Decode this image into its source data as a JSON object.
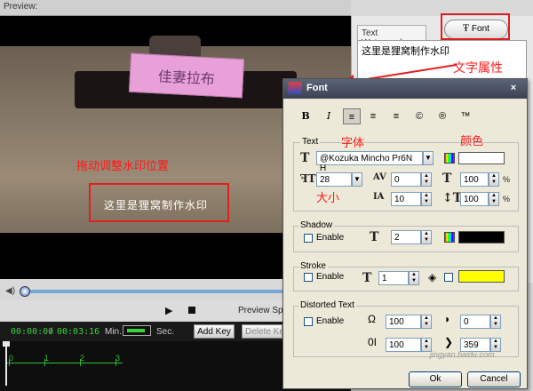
{
  "preview": {
    "label": "Preview:"
  },
  "video": {
    "card_text": "佳妻拉布",
    "drag_hint": "拖动调整水印位置",
    "watermark_text": "这里是狸窝制作水印"
  },
  "right_panel": {
    "tab_text_watermark": "Text Watermark",
    "font_tab": "Font",
    "input_value": "这里是狸窝制作水印",
    "annotation": "文字属性"
  },
  "player": {
    "preview_speed": "Preview Spe",
    "time_current": "00:00:00",
    "time_sep": "/",
    "time_total": "00:03:16",
    "min_label": "Min.",
    "sec_label": "Sec.",
    "add_key": "Add Key",
    "delete_key": "Delete Key",
    "ruler": [
      "0",
      "1",
      "2",
      "3"
    ]
  },
  "dialog": {
    "title": "Font",
    "close": "×",
    "format_buttons": [
      "B",
      "I",
      "≡",
      "≡",
      "≡",
      "©",
      "®",
      "™"
    ],
    "text_group": {
      "label": "Text",
      "font_name": "@Kozuka Mincho Pr6N H",
      "size": "28",
      "spacing_x": "0",
      "spacing_y": "10",
      "scale_w": "100",
      "scale_h": "100",
      "pct": "%",
      "color": "#ffffff",
      "anno_font": "字体",
      "anno_color": "颜色",
      "anno_size": "大小"
    },
    "shadow_group": {
      "label": "Shadow",
      "enable": "Enable",
      "value": "2",
      "color": "#000000"
    },
    "stroke_group": {
      "label": "Stroke",
      "enable": "Enable",
      "value": "1",
      "color": "#ffff00"
    },
    "distorted_group": {
      "label": "Distorted Text",
      "enable": "Enable",
      "v1": "100",
      "v2": "0",
      "v3": "100",
      "v4": "359"
    },
    "ok": "Ok",
    "cancel": "Cancel"
  },
  "site_watermark": "jingyan.baidu.com"
}
